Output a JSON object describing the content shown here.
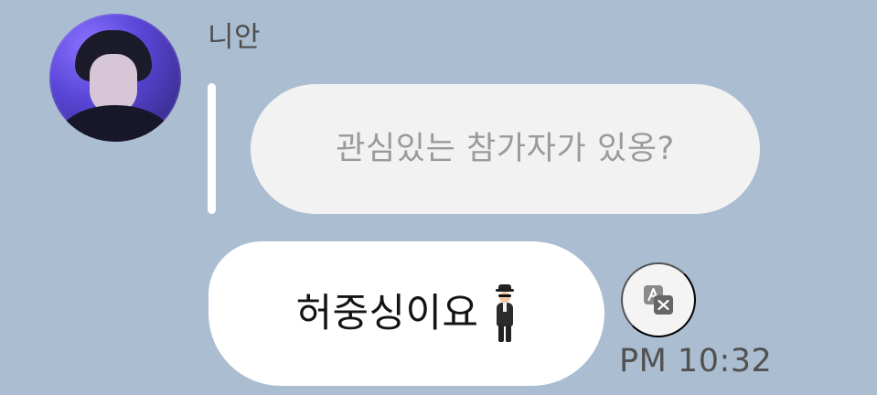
{
  "chat": {
    "sender_name": "니안",
    "quoted_text": "관심있는 참가자가 있옹?",
    "message_text": "허중싱이요",
    "timestamp": "PM 10:32"
  },
  "icons": {
    "avatar": "avatar",
    "translate": "translate-icon",
    "emoji": "man-in-suit-emoji"
  },
  "colors": {
    "background": "#abbdd0",
    "bubble": "#ffffff",
    "quoted_bubble": "#f2f2f3",
    "text_primary": "#141414",
    "text_secondary": "#9a9a9a"
  }
}
